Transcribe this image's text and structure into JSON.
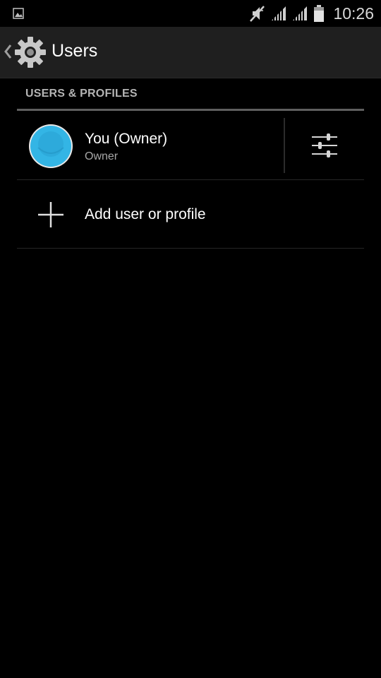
{
  "status_bar": {
    "time": "10:26",
    "icons": [
      "image-notification-icon",
      "vibrate-mute-icon",
      "signal-icon",
      "signal-icon",
      "battery-icon"
    ]
  },
  "action_bar": {
    "title": "Users",
    "back_icon": "chevron-left-icon",
    "app_icon": "settings-gear-icon"
  },
  "section": {
    "header": "USERS & PROFILES"
  },
  "users": [
    {
      "name": "You (Owner)",
      "subtitle": "Owner",
      "avatar_color": "#33b5e5",
      "settings_icon": "sliders-icon"
    }
  ],
  "add_user": {
    "label": "Add user or profile",
    "icon": "plus-icon"
  },
  "colors": {
    "background": "#000000",
    "action_bar": "#1f1f1f",
    "accent": "#33b5e5",
    "section_header": "#b4b4b4"
  }
}
